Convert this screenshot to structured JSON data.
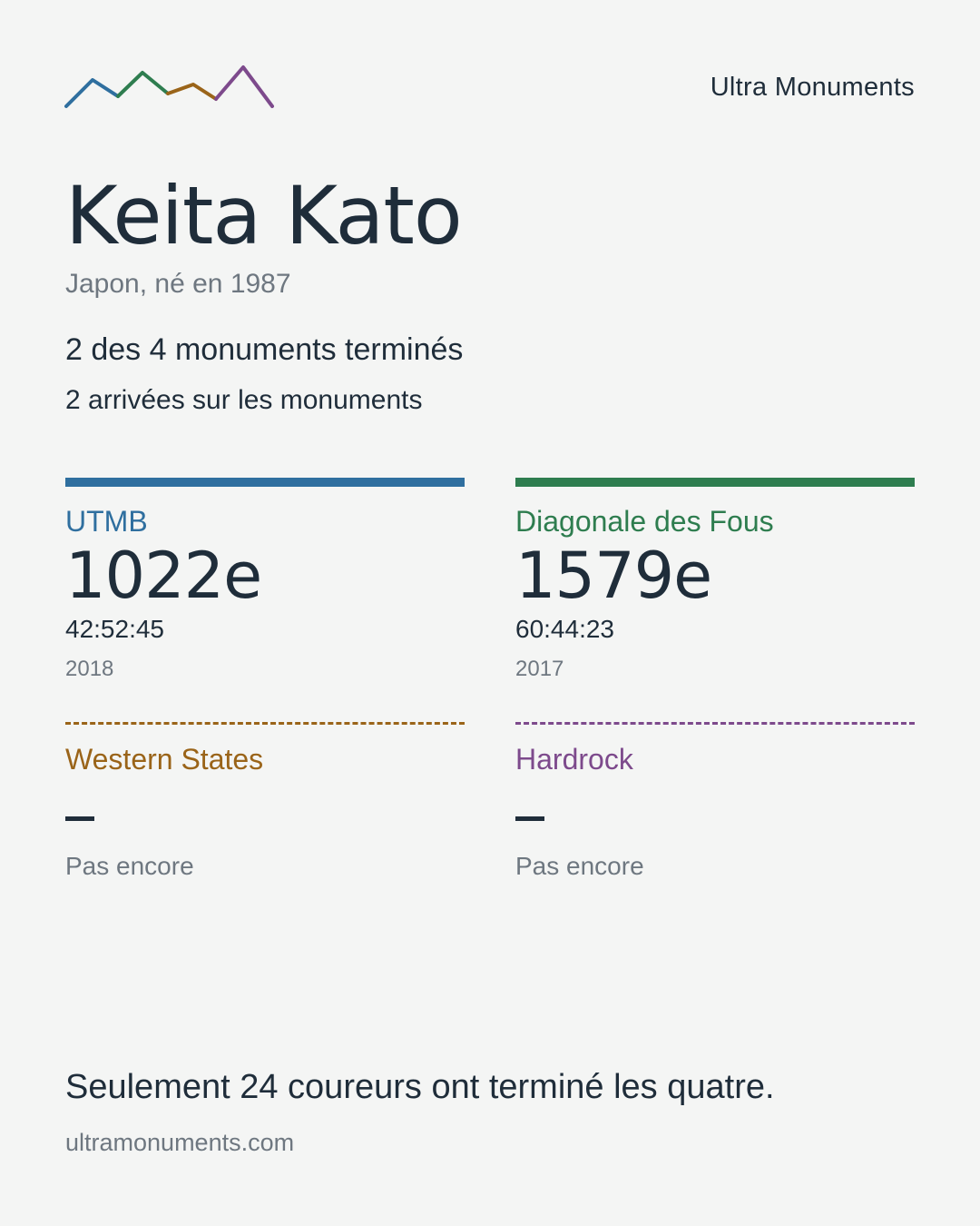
{
  "brand": {
    "name": "Ultra Monuments",
    "logo_icon": "mountain-ridge-logo",
    "logo_colors": [
      "#2f6f9f",
      "#2e7d4f",
      "#9a6419",
      "#7d4a8c"
    ]
  },
  "runner": {
    "name": "Keita Kato",
    "subtitle": "Japon, né en 1987",
    "summary": "2 des 4 monuments terminés",
    "finishes": "2 arrivées sur les monuments"
  },
  "races": [
    {
      "name": "UTMB",
      "color": "#2f6f9f",
      "completed": true,
      "rank": "1022e",
      "time": "42:52:45",
      "year": "2018"
    },
    {
      "name": "Diagonale des Fous",
      "color": "#2e7d4f",
      "completed": true,
      "rank": "1579e",
      "time": "60:44:23",
      "year": "2017"
    },
    {
      "name": "Western States",
      "color": "#9a6419",
      "completed": false,
      "status": "Pas encore"
    },
    {
      "name": "Hardrock",
      "color": "#7d4a8c",
      "completed": false,
      "status": "Pas encore"
    }
  ],
  "footer": {
    "text": "Seulement 24 coureurs ont terminé les quatre.",
    "url": "ultramonuments.com"
  }
}
